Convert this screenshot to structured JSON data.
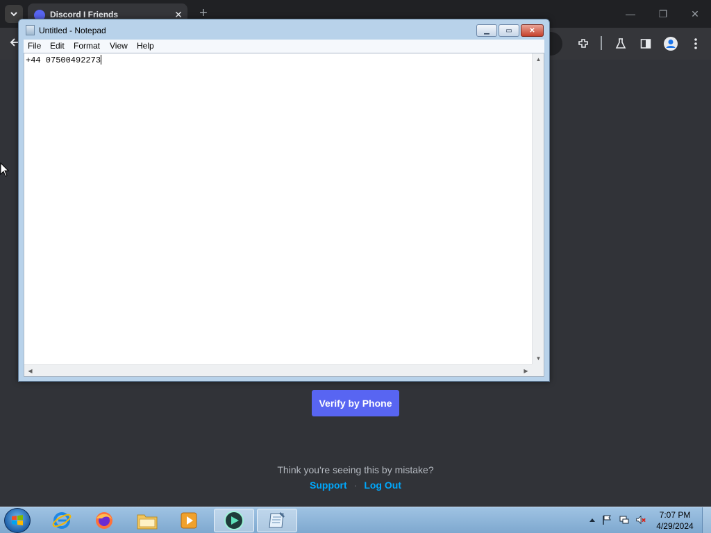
{
  "browser": {
    "tab": {
      "title": "Discord I Friends",
      "close_glyph": "✕"
    },
    "new_tab_glyph": "+",
    "window_controls": {
      "minimize": "—",
      "restore": "❐",
      "close": "✕"
    }
  },
  "discord": {
    "verify_button": "Verify by Phone",
    "mistake_text": "Think you're seeing this by mistake?",
    "support_link": "Support",
    "separator": "·",
    "logout_link": "Log Out"
  },
  "notepad": {
    "title": "Untitled - Notepad",
    "menu": [
      "File",
      "Edit",
      "Format",
      "View",
      "Help"
    ],
    "content": "+44 07500492273",
    "buttons": {
      "minimize": "▁",
      "maximize": "▭",
      "close": "✕"
    }
  },
  "taskbar": {
    "time": "7:07 PM",
    "date": "4/29/2024",
    "pinned": [
      "internet-explorer",
      "firefox",
      "file-explorer",
      "media-player",
      "discord-app",
      "notepad"
    ]
  },
  "colors": {
    "discord_bg": "#313338",
    "blurple": "#5865f2",
    "link": "#00a8fc",
    "chrome_dark": "#202124"
  }
}
